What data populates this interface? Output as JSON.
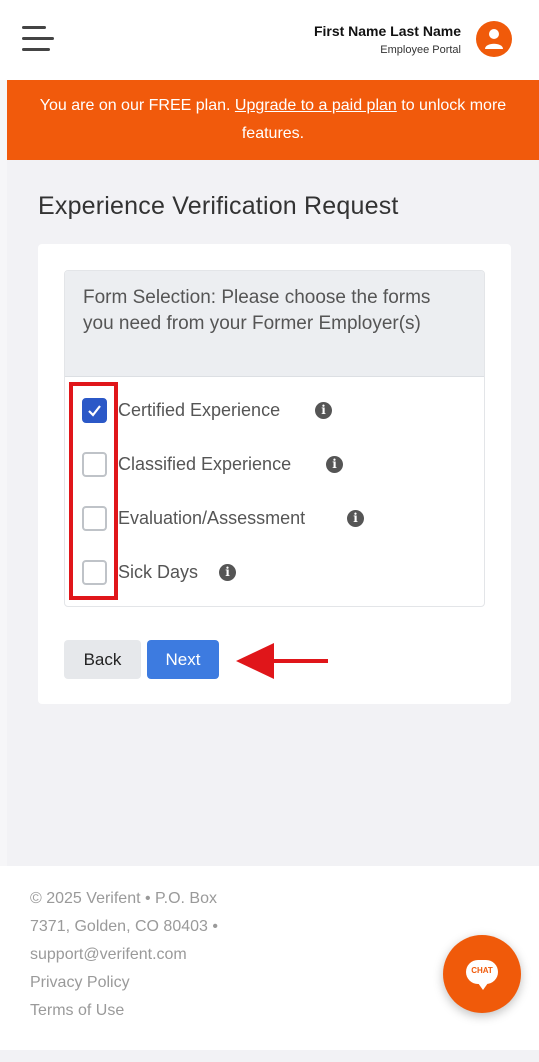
{
  "header": {
    "user_name": "First Name Last Name",
    "user_subtitle": "Employee Portal",
    "menu_icon": "hamburger-menu-icon",
    "avatar_icon": "user-icon"
  },
  "banner": {
    "text_before": "You are on our FREE plan. ",
    "link_text": "Upgrade to a paid plan",
    "text_after": " to unlock more features."
  },
  "page": {
    "title": "Experience Verification Request"
  },
  "form": {
    "heading": "Form Selection: Please choose the forms you need from your Former Employer(s)",
    "options": [
      {
        "label": "Certified Experience",
        "checked": true
      },
      {
        "label": "Classified Experience",
        "checked": false
      },
      {
        "label": "Evaluation/Assessment",
        "checked": false
      },
      {
        "label": "Sick Days",
        "checked": false
      }
    ],
    "info_icon": "info-icon"
  },
  "buttons": {
    "back": "Back",
    "next": "Next"
  },
  "footer": {
    "line1": "© 2025 Verifent • P.O. Box",
    "line2": "7371, Golden, CO 80403 •",
    "line3": "support@verifent.com",
    "privacy": "Privacy Policy",
    "terms": "Terms of Use"
  },
  "chat": {
    "label": "CHAT"
  },
  "colors": {
    "brand_orange": "#f15a0c",
    "primary_blue": "#3d7be0",
    "highlight_red": "#e0161a"
  }
}
